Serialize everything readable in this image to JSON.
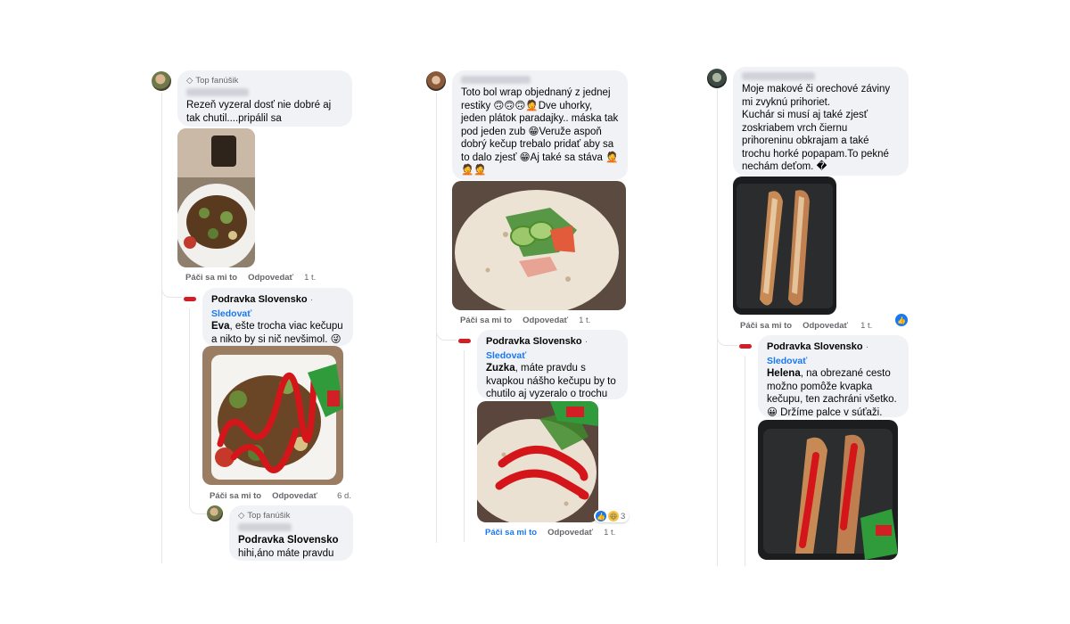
{
  "labels": {
    "top_fan": "Top fanúšik",
    "like": "Páči sa mi to",
    "reply": "Odpovedať",
    "follow": "Sledovať",
    "brand": "Podravka Slovensko",
    "separator": "·"
  },
  "col1": {
    "comment": {
      "text": "Rezeň vyzeral dosť nie dobré aj tak chutil....pripálil sa",
      "time": "1 t."
    },
    "reply": {
      "mention": "Eva",
      "text": ", ešte trocha viac kečupu a nikto by si nič nevšimol. 😜",
      "time": "6 d."
    },
    "sub_reply": {
      "title": "Podravka Slovensko",
      "text": "hihi,áno máte pravdu"
    }
  },
  "col2": {
    "comment": {
      "text": "Toto bol wrap objednaný z jednej restiky 🙃🙃🙃🤦Dve uhorky, jeden plátok paradajky.. máska tak pod jeden zub 😁Veruže aspoň dobrý kečup trebalo pridať aby sa to dalo zjesť 😁Aj také sa stáva 🤦🤦🤦",
      "time": "1 t."
    },
    "reply": {
      "mention": "Zuzka",
      "text": ", máte pravdu s kvapkou nášho kečupu by to chutilo aj vyzeralo o trochu lepšie.😜",
      "time": "1 t.",
      "reaction_count": "3"
    }
  },
  "col3": {
    "comment": {
      "text": "Moje makové či orechové záviny mi zvyknú prihoriet.\nKuchár si musí aj také zjesť\nzoskriabem vrch čiernu prihoreninu obkrajam a také trochu horké popapam.To pekné nechám deťom. �",
      "time": "1 t."
    },
    "reply": {
      "mention": "Helena",
      "text": ", na obrezané cesto možno pomôže kvapka kečupu, ten zachráni všetko.😀 Držíme palce v súťaži."
    }
  },
  "colors": {
    "bubble": "#f0f2f5",
    "link": "#1877f2",
    "meta": "#65676b",
    "brand_red": "#d21f26"
  }
}
